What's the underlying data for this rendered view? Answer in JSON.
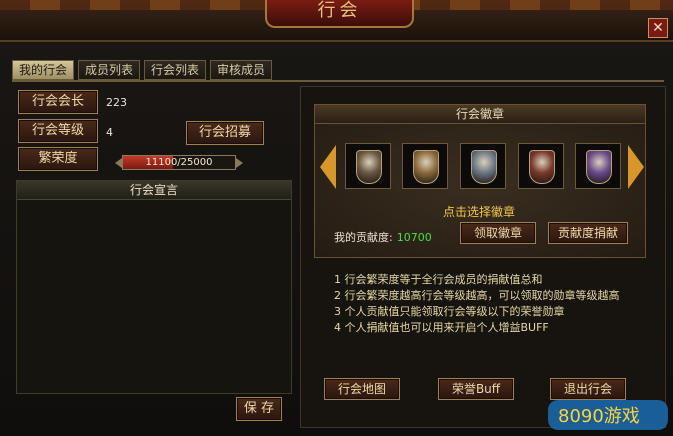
{
  "window": {
    "title": "行会",
    "close_icon": "close-icon"
  },
  "tabs": [
    {
      "label": "我的行会",
      "active": true
    },
    {
      "label": "成员列表",
      "active": false
    },
    {
      "label": "行会列表",
      "active": false
    },
    {
      "label": "审核成员",
      "active": false
    }
  ],
  "left": {
    "leader_label": "行会会长",
    "leader_value": "223",
    "level_label": "行会等级",
    "level_value": "4",
    "recruit_button": "行会招募",
    "prosperity_label": "繁荣度",
    "prosperity_text": "11100/25000",
    "prosperity_fraction": 0.444,
    "declaration_title": "行会宣言",
    "save_button": "保 存"
  },
  "badge": {
    "title": "行会徽章",
    "pick_text": "点击选择徽章",
    "contribution_label": "我的贡献度:",
    "contribution_value": "10700",
    "claim_button": "领取徽章",
    "donate_button": "贡献度捐献",
    "badges": [
      {
        "name": "badge-1",
        "color": "#6a5840"
      },
      {
        "name": "badge-2",
        "color": "#8b6a3a"
      },
      {
        "name": "badge-3",
        "color": "#6c7684"
      },
      {
        "name": "badge-4",
        "color": "#7a3a2a"
      },
      {
        "name": "badge-5",
        "color": "#6a4a8a"
      }
    ]
  },
  "info": {
    "lines": [
      "1 行会繁荣度等于全行会成员的捐献值总和",
      "2 行会繁荣度越高行会等级越高，可以领取的勋章等级越高",
      "3 个人贡献值只能领取行会等级以下的荣誉勋章",
      "4 个人捐献值也可以用来开启个人增益BUFF"
    ]
  },
  "bottom_buttons": {
    "map": "行会地图",
    "honor": "荣誉Buff",
    "quit": "退出行会"
  },
  "watermark": {
    "text": "8090游戏"
  }
}
